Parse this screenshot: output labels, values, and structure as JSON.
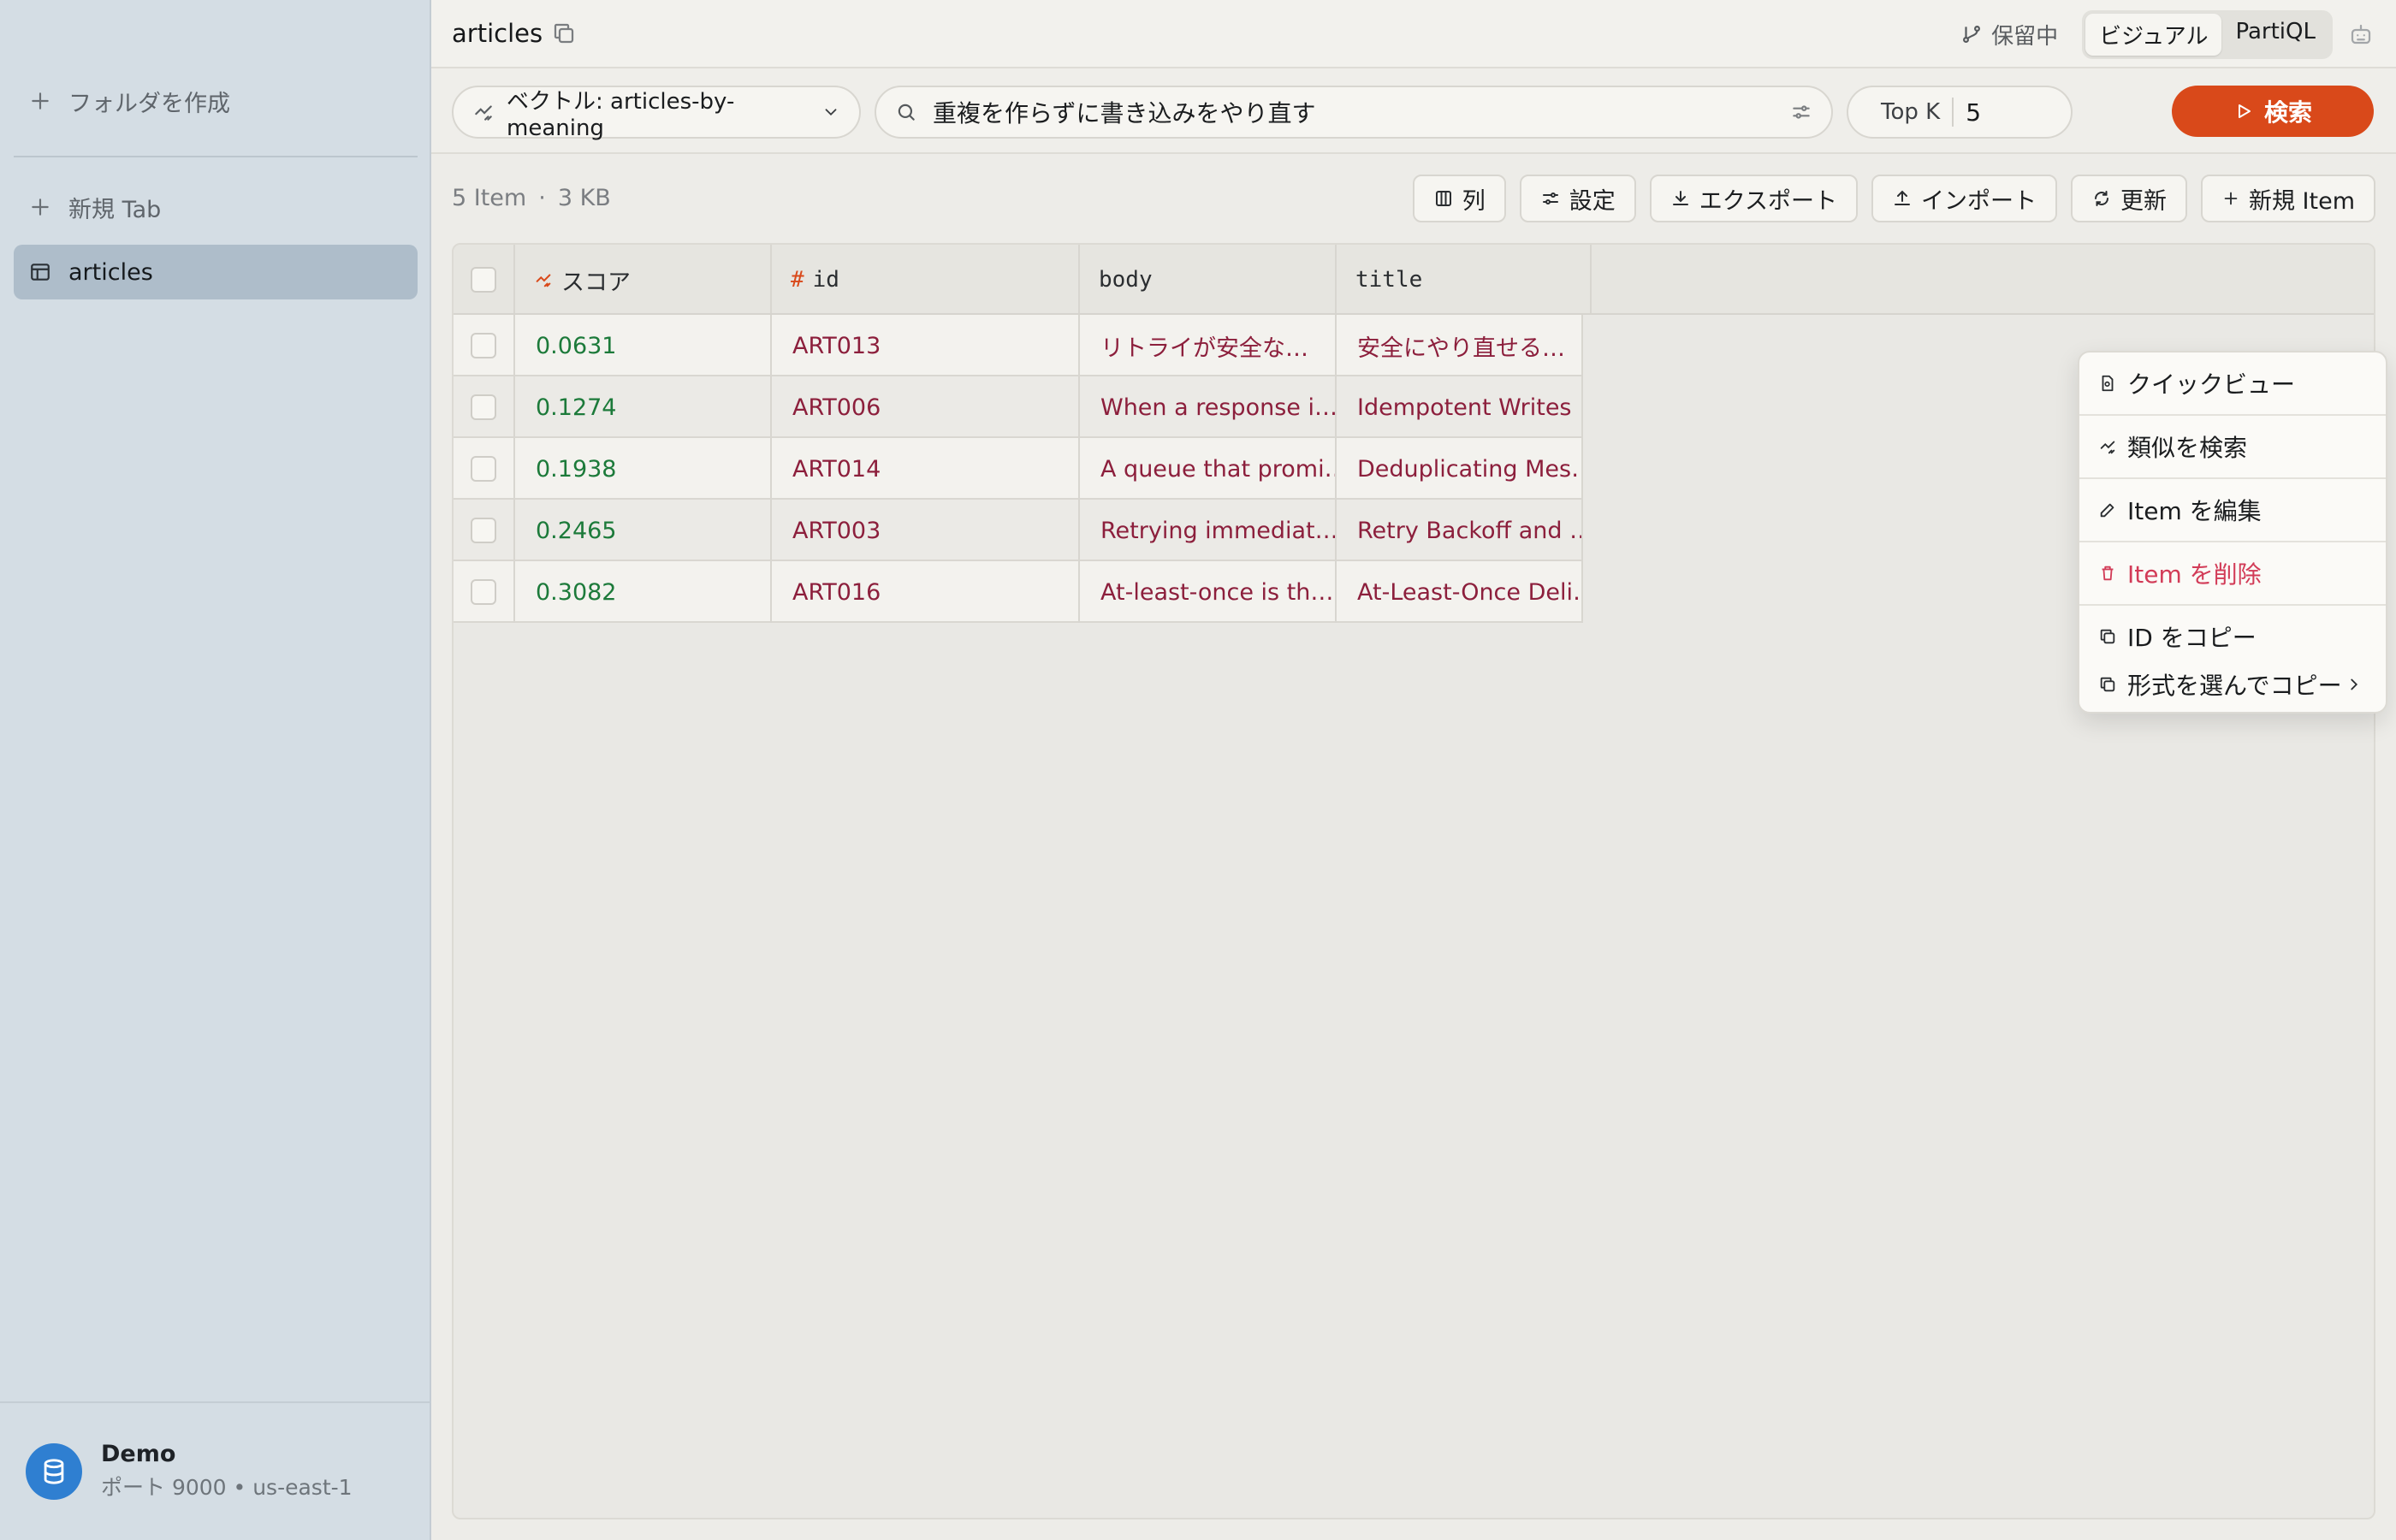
{
  "sidebar": {
    "create_folder": "フォルダを作成",
    "new_tab": "新規 Tab",
    "active_table": "articles",
    "connection": {
      "name": "Demo",
      "details": "ポート 9000 • us-east-1"
    }
  },
  "header": {
    "tab_title": "articles",
    "pending": "保留中",
    "modes": [
      "ビジュアル",
      "PartiQL"
    ],
    "active_mode": "ビジュアル"
  },
  "query": {
    "vector_label": "ベクトル: articles-by-meaning",
    "search_text": "重複を作らずに書き込みをやり直す",
    "topk_label": "Top K",
    "topk_value": "5",
    "search_button": "検索"
  },
  "summary": {
    "items": "5 Item",
    "dot": "·",
    "size": "3 KB"
  },
  "toolbar": {
    "columns": "列",
    "settings": "設定",
    "export": "エクスポート",
    "import": "インポート",
    "refresh": "更新",
    "new_item": "新規 Item"
  },
  "table": {
    "headers": {
      "score": "スコア",
      "id": "id",
      "body": "body",
      "title": "title"
    },
    "rows": [
      {
        "score": "0.0631",
        "id": "ART013",
        "body": "リトライが安全な…",
        "title": "安全にやり直せる…"
      },
      {
        "score": "0.1274",
        "id": "ART006",
        "body": "When a response i…",
        "title": "Idempotent Writes …"
      },
      {
        "score": "0.1938",
        "id": "ART014",
        "body": "A queue that promi…",
        "title": "Deduplicating Mes…"
      },
      {
        "score": "0.2465",
        "id": "ART003",
        "body": "Retrying immediat…",
        "title": "Retry Backoff and …"
      },
      {
        "score": "0.3082",
        "id": "ART016",
        "body": "At-least-once is th…",
        "title": "At-Least-Once Deli…"
      }
    ]
  },
  "context_menu": {
    "quick_view": "クイックビュー",
    "find_similar": "類似を検索",
    "edit_item": "Item を編集",
    "delete_item": "Item を削除",
    "copy_id": "ID をコピー",
    "copy_as": "形式を選んでコピー"
  },
  "colors": {
    "accent": "#d9491a",
    "score": "#1c7a3a",
    "value": "#8c1f3c",
    "danger": "#d23b57",
    "sidebar_bg": "#d4dde4",
    "sidebar_active": "#aebdca"
  }
}
